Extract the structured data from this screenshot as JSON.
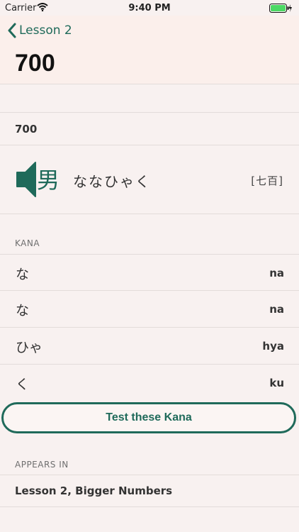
{
  "status": {
    "carrier": "Carrier",
    "time": "9:40 PM"
  },
  "nav": {
    "back_label": "Lesson 2"
  },
  "page": {
    "title": "700"
  },
  "word": {
    "value": "700",
    "kanji_icon_char": "男",
    "reading": "ななひゃく",
    "kanji": "[七百]"
  },
  "kana": {
    "header": "KANA",
    "items": [
      {
        "kana": "な",
        "romaji": "na"
      },
      {
        "kana": "な",
        "romaji": "na"
      },
      {
        "kana": "ひゃ",
        "romaji": "hya"
      },
      {
        "kana": "く",
        "romaji": "ku"
      }
    ]
  },
  "test_button": {
    "label": "Test these Kana"
  },
  "appears_in": {
    "header": "APPEARS IN",
    "items": [
      {
        "label": "Lesson 2, Bigger Numbers"
      }
    ]
  },
  "colors": {
    "accent": "#1f6a5a",
    "background": "#f8f1f0"
  }
}
